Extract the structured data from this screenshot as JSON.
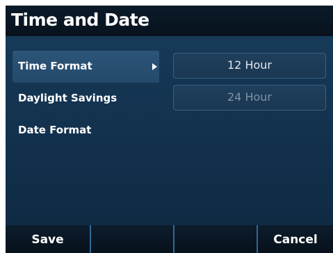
{
  "header": {
    "title": "Time and Date"
  },
  "menu": {
    "items": [
      {
        "label": "Time Format",
        "selected": true
      },
      {
        "label": "Daylight Savings",
        "selected": false
      },
      {
        "label": "Date Format",
        "selected": false
      }
    ]
  },
  "options": {
    "items": [
      {
        "label": "12 Hour",
        "state": "active"
      },
      {
        "label": "24 Hour",
        "state": "dimmed"
      }
    ]
  },
  "softkeys": {
    "key1": "Save",
    "key2": "",
    "key3": "",
    "key4": "Cancel"
  },
  "icons": {
    "submenu_arrow": "triangle-right-icon"
  },
  "colors": {
    "background": "#12304a",
    "title_bar": "#0b1a29",
    "selected_item": "#2c5579",
    "option_border": "#3c5f7f",
    "softkey_divider": "#2f6a96",
    "text": "#ffffff",
    "dimmed_text": "#7f93a6"
  }
}
